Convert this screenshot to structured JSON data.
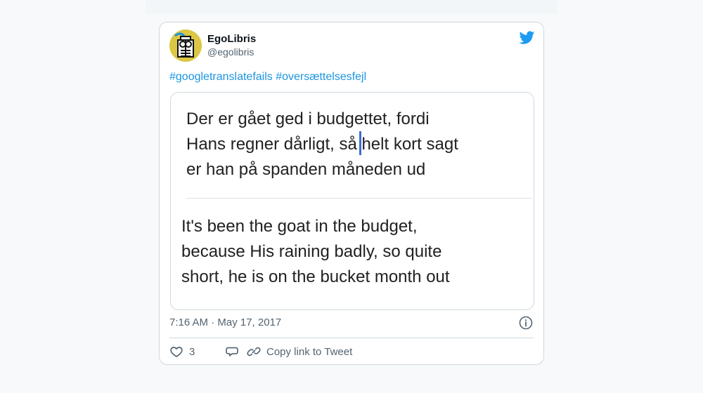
{
  "tweet": {
    "account": {
      "name": "EgoLibris",
      "handle": "@egolibris",
      "avatar_color": "#dbc744"
    },
    "brand_icon": "twitter-bird-icon",
    "hashtags": [
      "#googletranslatefails",
      "#oversættelsesfejl"
    ],
    "image": {
      "danish_text": "Der er gået ged i budgettet, fordi\nHans regner dårligt, så helt kort sagt\ner han på spanden måneden ud",
      "english_text": "It's been the goat in the budget,\nbecause His raining badly, so quite\nshort, he is on the bucket month out"
    },
    "timestamp": "7:16 AM · May 17, 2017",
    "actions": {
      "like_count": "3",
      "copy_link_label": "Copy link to Tweet"
    }
  },
  "colors": {
    "link": "#1b95e0",
    "brand": "#1d9bf0",
    "secondary_text": "#536471",
    "cursor": "#3d6bd6"
  },
  "icons": [
    "twitter-bird-icon",
    "info-icon",
    "heart-icon",
    "reply-icon",
    "link-icon"
  ]
}
